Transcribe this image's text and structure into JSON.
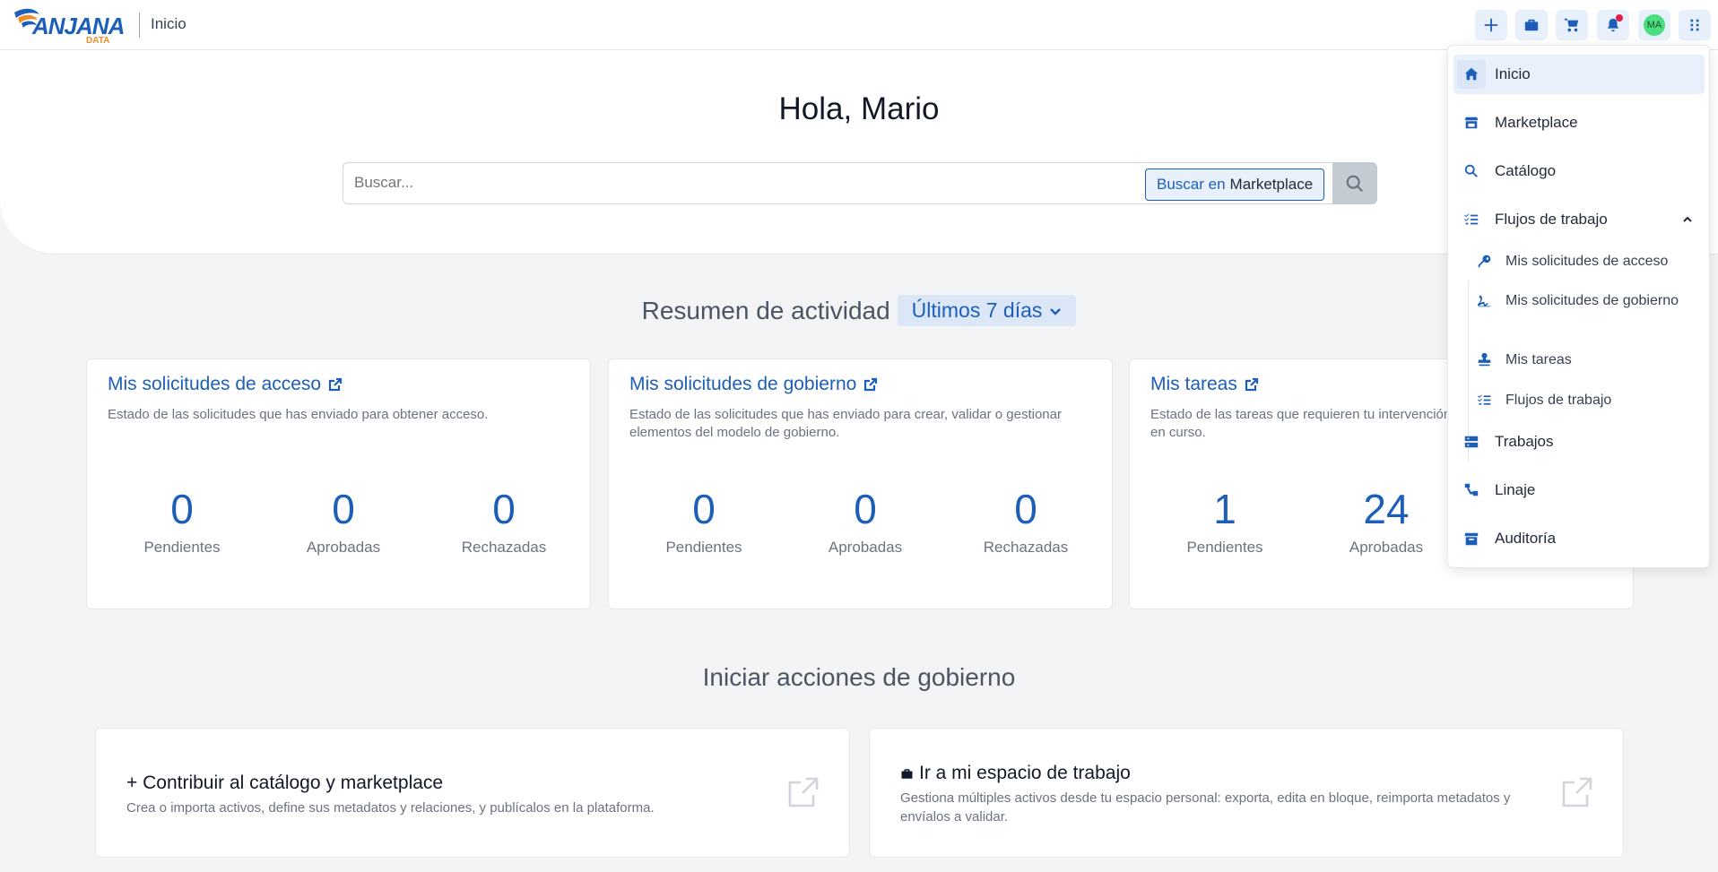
{
  "header": {
    "logo_text": "ANJANA",
    "logo_subtext": "DATA",
    "breadcrumb": "Inicio",
    "avatar_initials": "MA"
  },
  "hero": {
    "greeting": "Hola, Mario",
    "search_placeholder": "Buscar...",
    "search_scope_prefix": "Buscar en",
    "search_scope": "Marketplace"
  },
  "activity": {
    "title": "Resumen de actividad",
    "period": "Últimos 7 días",
    "cards": [
      {
        "title": "Mis solicitudes de acceso",
        "desc": "Estado de las solicitudes que has enviado para obtener acceso.",
        "stats": [
          {
            "value": "0",
            "label": "Pendientes"
          },
          {
            "value": "0",
            "label": "Aprobadas"
          },
          {
            "value": "0",
            "label": "Rechazadas"
          }
        ]
      },
      {
        "title": "Mis solicitudes de gobierno",
        "desc": "Estado de las solicitudes que has enviado para crear, validar o gestionar elementos del modelo de gobierno.",
        "stats": [
          {
            "value": "0",
            "label": "Pendientes"
          },
          {
            "value": "0",
            "label": "Aprobadas"
          },
          {
            "value": "0",
            "label": "Rechazadas"
          }
        ]
      },
      {
        "title": "Mis tareas",
        "desc": "Estado de las tareas que requieren tu intervención en curso.",
        "stats": [
          {
            "value": "1",
            "label": "Pendientes"
          },
          {
            "value": "24",
            "label": "Aprobadas"
          }
        ]
      }
    ]
  },
  "actions": {
    "title": "Iniciar acciones de gobierno",
    "items": [
      {
        "title": "+ Contribuir al catálogo y marketplace",
        "desc": "Crea o importa activos, define sus metadatos y relaciones, y publícalos en la plataforma."
      },
      {
        "title": "Ir a mi espacio de trabajo",
        "desc": "Gestiona múltiples activos desde tu espacio personal: exporta, edita en bloque, reimporta metadatos y envíalos a validar."
      }
    ]
  },
  "menu": {
    "items": [
      {
        "label": "Inicio",
        "icon": "home-icon"
      },
      {
        "label": "Marketplace",
        "icon": "store-icon"
      },
      {
        "label": "Catálogo",
        "icon": "search-icon"
      },
      {
        "label": "Flujos de trabajo",
        "icon": "list-check-icon"
      },
      {
        "label": "Trabajos",
        "icon": "server-icon"
      },
      {
        "label": "Linaje",
        "icon": "lineage-icon"
      },
      {
        "label": "Auditoría",
        "icon": "archive-icon"
      }
    ],
    "subitems": [
      {
        "label": "Mis solicitudes de acceso",
        "icon": "key-icon"
      },
      {
        "label": "Mis solicitudes de gobierno",
        "icon": "signature-icon"
      },
      {
        "label": "Mis tareas",
        "icon": "stamp-icon"
      },
      {
        "label": "Flujos de trabajo",
        "icon": "list-check-icon"
      }
    ]
  },
  "colors": {
    "primary": "#1d5fb8",
    "background": "#f3f4f6",
    "avatar": "#4ade80",
    "notification_dot": "#e11d48"
  }
}
